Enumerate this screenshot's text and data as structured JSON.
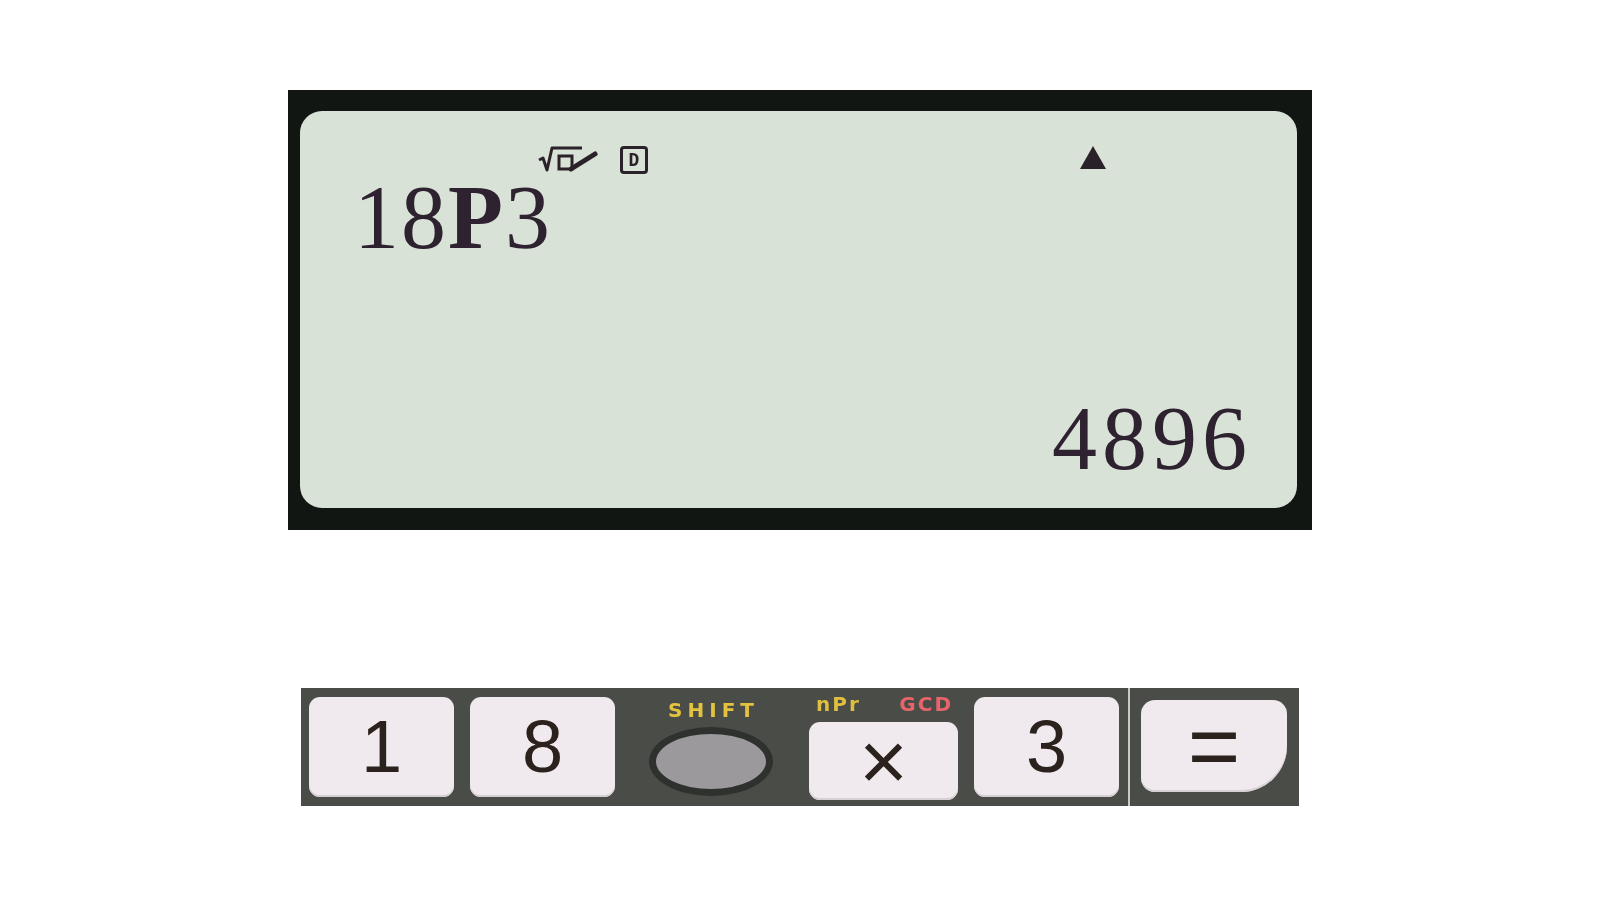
{
  "display": {
    "indicators": [
      {
        "kind": "math"
      },
      {
        "kind": "letter",
        "text": "D"
      },
      {
        "kind": "up"
      }
    ],
    "expression": "18**P**3",
    "result": "4896"
  },
  "keys": [
    {
      "kind": "digit",
      "label": "1"
    },
    {
      "kind": "digit",
      "label": "8"
    },
    {
      "kind": "shift",
      "label": "SHIFT"
    },
    {
      "kind": "operator",
      "label": "×",
      "shift_label": "nPr",
      "alpha_label": "GCD"
    },
    {
      "kind": "digit",
      "label": "3"
    },
    {
      "kind": "equals",
      "label": "="
    }
  ]
}
